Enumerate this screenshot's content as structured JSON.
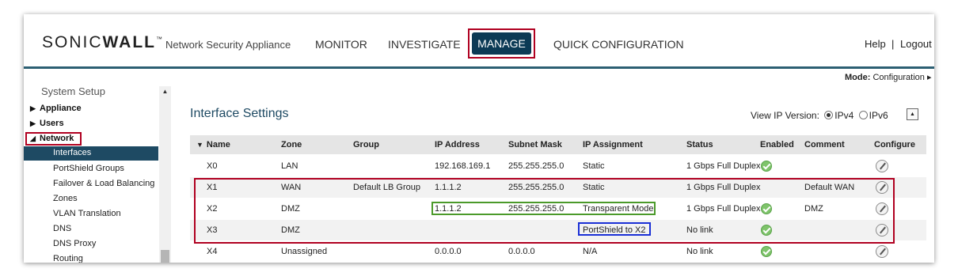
{
  "header": {
    "logo_pre": "SONIC",
    "logo_bold": "WALL",
    "logo_tm": "™",
    "subtitle": "Network Security Appliance",
    "nav": [
      "MONITOR",
      "INVESTIGATE",
      "MANAGE",
      "QUICK CONFIGURATION"
    ],
    "help": "Help",
    "separator": "|",
    "logout": "Logout"
  },
  "mode": {
    "label": "Mode:",
    "value": "Configuration ▸"
  },
  "sidebar": {
    "title": "System Setup",
    "appliance": "Appliance",
    "users": "Users",
    "network": "Network",
    "items": [
      "Interfaces",
      "PortShield Groups",
      "Failover & Load Balancing",
      "Zones",
      "VLAN Translation",
      "DNS",
      "DNS Proxy",
      "Routing"
    ]
  },
  "main": {
    "title": "Interface Settings",
    "view_ip_label": "View IP Version:",
    "ipv4": "IPv4",
    "ipv6": "IPv6",
    "selected_ip_version": "IPv4",
    "columns": [
      "Name",
      "Zone",
      "Group",
      "IP Address",
      "Subnet Mask",
      "IP Assignment",
      "Status",
      "Enabled",
      "Comment",
      "Configure"
    ],
    "rows": [
      {
        "name": "X0",
        "zone": "LAN",
        "group": "",
        "ip": "192.168.169.1",
        "mask": "255.255.255.0",
        "assignment": "Static",
        "status": "1 Gbps Full Duplex",
        "enabled": true,
        "comment": ""
      },
      {
        "name": "X1",
        "zone": "WAN",
        "group": "Default LB Group",
        "ip": "1.1.1.2",
        "mask": "255.255.255.0",
        "assignment": "Static",
        "status": "1 Gbps Full Duplex",
        "enabled": false,
        "comment": "Default WAN"
      },
      {
        "name": "X2",
        "zone": "DMZ",
        "group": "",
        "ip": "1.1.1.2",
        "mask": "255.255.255.0",
        "assignment": "Transparent Mode",
        "status": "1 Gbps Full Duplex",
        "enabled": true,
        "comment": "DMZ"
      },
      {
        "name": "X3",
        "zone": "DMZ",
        "group": "",
        "ip": "",
        "mask": "",
        "assignment": "PortShield to X2",
        "status": "No link",
        "enabled": true,
        "comment": ""
      },
      {
        "name": "X4",
        "zone": "Unassigned",
        "group": "",
        "ip": "0.0.0.0",
        "mask": "0.0.0.0",
        "assignment": "N/A",
        "status": "No link",
        "enabled": true,
        "comment": ""
      }
    ]
  },
  "colors": {
    "accent": "#1e4a63",
    "highlight_red": "#b00020",
    "highlight_green": "#4b9a2a",
    "highlight_blue": "#1a2fd6"
  }
}
